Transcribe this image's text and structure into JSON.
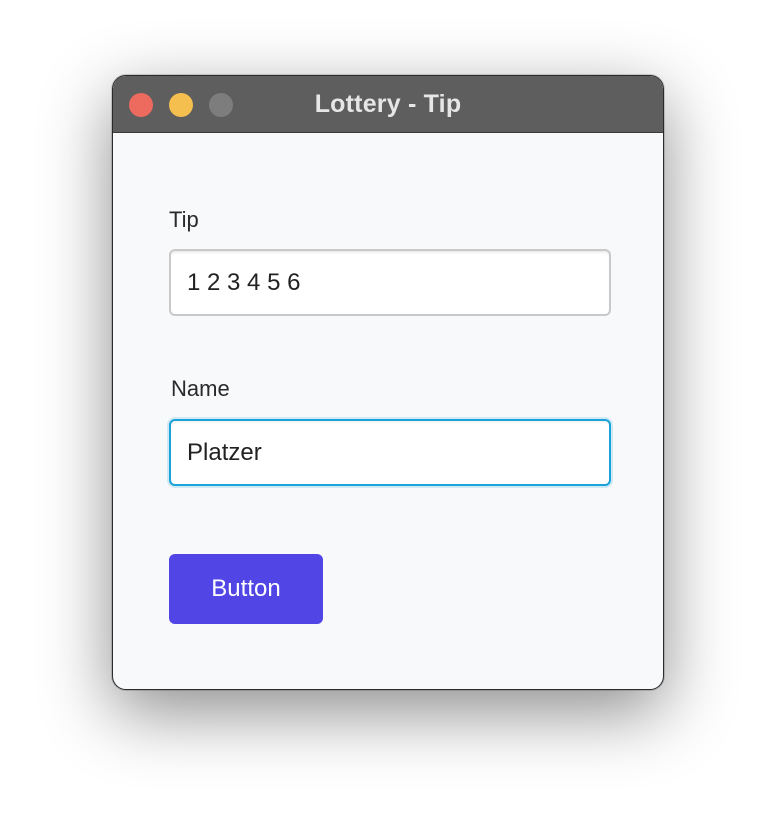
{
  "window": {
    "title": "Lottery - Tip"
  },
  "form": {
    "tip": {
      "label": "Tip",
      "value": "1 2 3 4 5 6"
    },
    "name": {
      "label": "Name",
      "value": "Platzer"
    },
    "submit_label": "Button"
  },
  "colors": {
    "titlebar": "#5e5e5e",
    "close": "#ed6a5e",
    "minimize": "#f5bf4f",
    "zoom": "#7d7d7d",
    "focus_ring": "#1aa3d9",
    "button": "#5146e5"
  }
}
